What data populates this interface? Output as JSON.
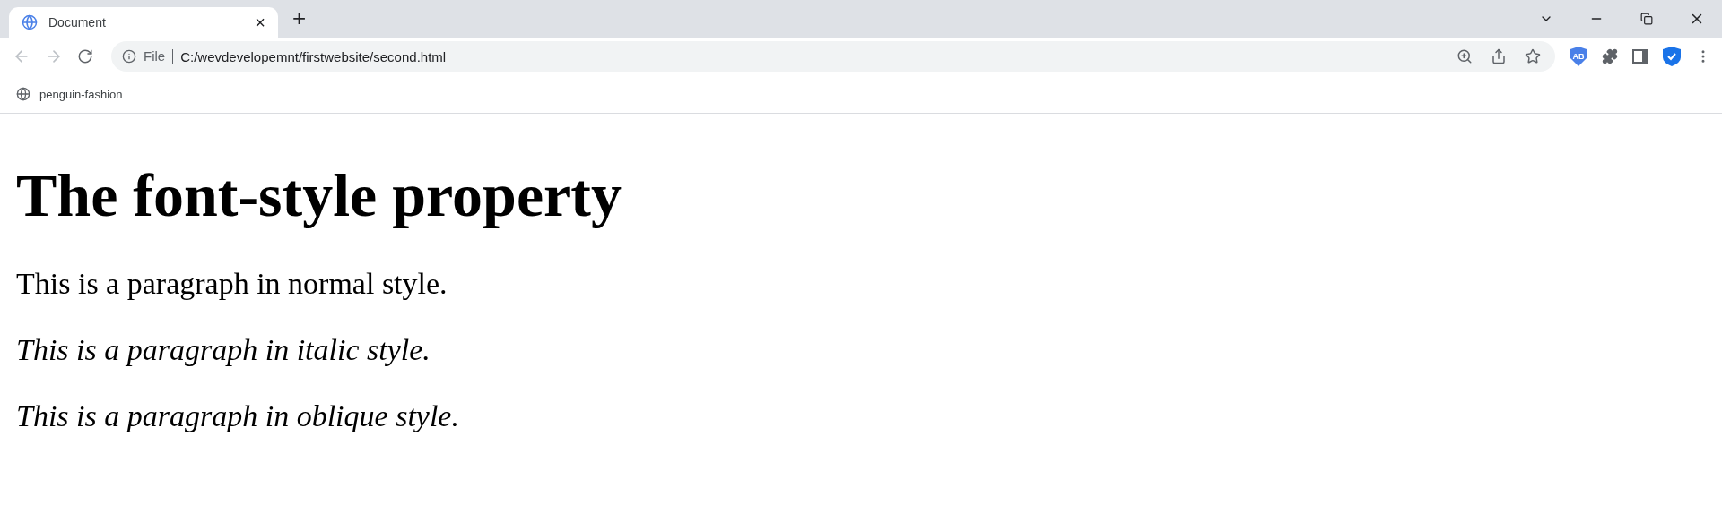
{
  "tabs": [
    {
      "title": "Document",
      "selected": true,
      "close": "×"
    }
  ],
  "new_tab": "+",
  "address_bar": {
    "scheme": "File",
    "url": "C:/wevdevelopemnt/firstwebsite/second.html"
  },
  "extension_badge": "AB",
  "bookmarks": [
    {
      "label": "penguin-fashion"
    }
  ],
  "page": {
    "heading": "The font-style property",
    "paragraphs": [
      {
        "text": "This is a paragraph in normal style.",
        "kind": "normal"
      },
      {
        "text": "This is a paragraph in italic style.",
        "kind": "italic"
      },
      {
        "text": "This is a paragraph in oblique style.",
        "kind": "oblique"
      }
    ]
  }
}
